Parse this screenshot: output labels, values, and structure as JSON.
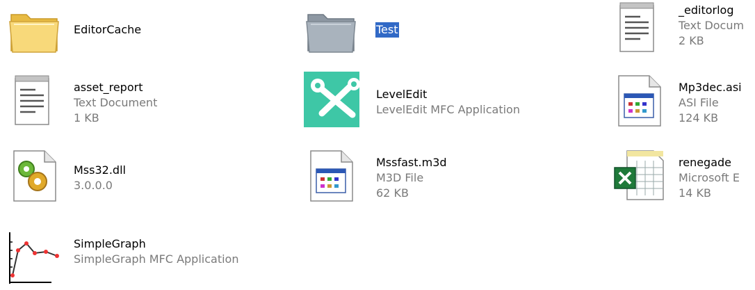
{
  "items": [
    {
      "name": "EditorCache",
      "detail1": "",
      "detail2": "",
      "icon": "folder-icon"
    },
    {
      "name": "Test",
      "detail1": "",
      "detail2": "",
      "icon": "folder-selected-icon",
      "selected": true
    },
    {
      "name": "_editorlog",
      "detail1": "Text Docum",
      "detail2": "2 KB",
      "icon": "text-document-icon"
    },
    {
      "name": "asset_report",
      "detail1": "Text Document",
      "detail2": "1 KB",
      "icon": "text-document-icon"
    },
    {
      "name": "LevelEdit",
      "detail1": "LevelEdit MFC Application",
      "detail2": "",
      "icon": "tools-app-icon"
    },
    {
      "name": "Mp3dec.asi",
      "detail1": "ASI File",
      "detail2": "124 KB",
      "icon": "system-file-icon"
    },
    {
      "name": "Mss32.dll",
      "detail1": "3.0.0.0",
      "detail2": "",
      "icon": "dll-gear-icon"
    },
    {
      "name": "Mssfast.m3d",
      "detail1": "M3D File",
      "detail2": "62 KB",
      "icon": "system-file-icon"
    },
    {
      "name": "renegade",
      "detail1": "Microsoft E",
      "detail2": "14 KB",
      "icon": "excel-icon"
    },
    {
      "name": "SimpleGraph",
      "detail1": "SimpleGraph MFC Application",
      "detail2": "",
      "icon": "graph-app-icon"
    }
  ],
  "colors": {
    "selection": "#3169c6",
    "detail_text": "#7a7a7a",
    "folder": "#f5d36b",
    "folder_selected": "#a3adb6"
  }
}
